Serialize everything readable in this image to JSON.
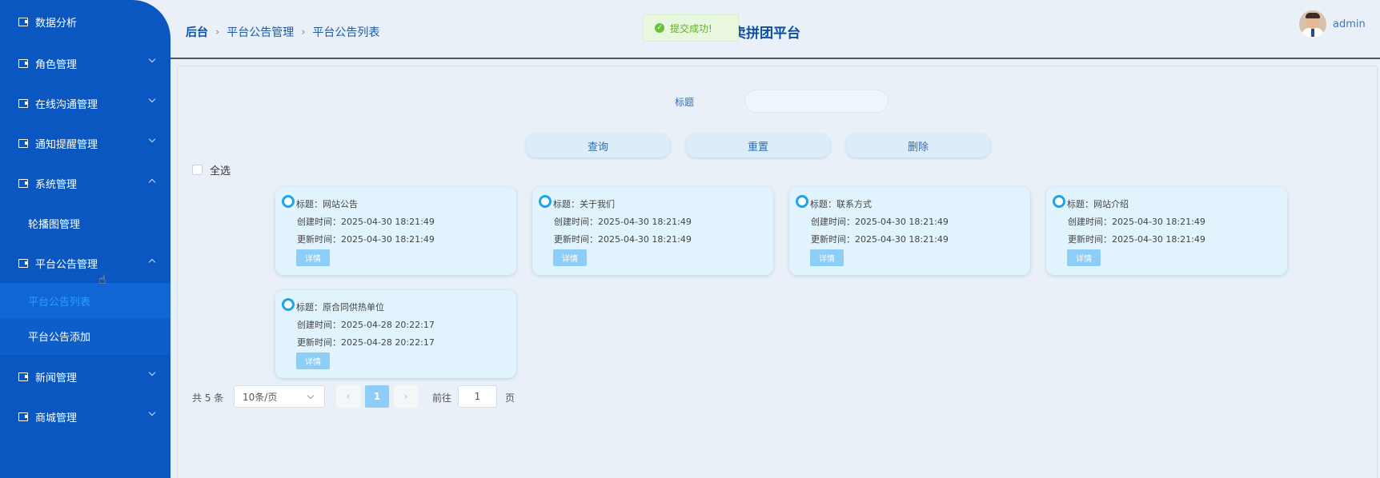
{
  "sidebar": {
    "items": [
      {
        "label": "数据分析"
      },
      {
        "label": "角色管理"
      },
      {
        "label": "在线沟通管理"
      },
      {
        "label": "通知提醒管理"
      },
      {
        "label": "系统管理"
      },
      {
        "label": "平台公告管理"
      },
      {
        "label": "新闻管理"
      },
      {
        "label": "商城管理"
      }
    ],
    "system_sub": "轮播图管理",
    "notice_subs": [
      {
        "label": "平台公告列表"
      },
      {
        "label": "平台公告添加"
      }
    ]
  },
  "header": {
    "breadcrumb": [
      "后台",
      "平台公告管理",
      "平台公告列表"
    ],
    "site_title": "卖拼团平台",
    "user": "admin"
  },
  "toast": {
    "text": "提交成功!"
  },
  "search": {
    "title_label": "标题",
    "title_value": ""
  },
  "buttons": {
    "query": "查询",
    "reset": "重置",
    "delete": "删除"
  },
  "select_all": "全选",
  "cards": [
    {
      "title": "标题：网站公告",
      "created": "创建时间：2025-04-30 18:21:49",
      "updated": "更新时间：2025-04-30 18:21:49",
      "detail": "详情"
    },
    {
      "title": "标题：关于我们",
      "created": "创建时间：2025-04-30 18:21:49",
      "updated": "更新时间：2025-04-30 18:21:49",
      "detail": "详情"
    },
    {
      "title": "标题：联系方式",
      "created": "创建时间：2025-04-30 18:21:49",
      "updated": "更新时间：2025-04-30 18:21:49",
      "detail": "详情"
    },
    {
      "title": "标题：网站介绍",
      "created": "创建时间：2025-04-30 18:21:49",
      "updated": "更新时间：2025-04-30 18:21:49",
      "detail": "详情"
    },
    {
      "title": "标题：原合同供热单位",
      "created": "创建时间：2025-04-28 20:22:17",
      "updated": "更新时间：2025-04-28 20:22:17",
      "detail": "详情"
    }
  ],
  "pagination": {
    "total": "共 5 条",
    "page_size": "10条/页",
    "prev": "‹",
    "current": "1",
    "next": "›",
    "goto_label": "前往",
    "goto_value": "1",
    "page_label": "页"
  },
  "colors": {
    "sidebar_bg": "#0a57c2",
    "active_sub": "#2d9cff",
    "accent": "#1ea5e9",
    "toast_text": "#59b327"
  }
}
